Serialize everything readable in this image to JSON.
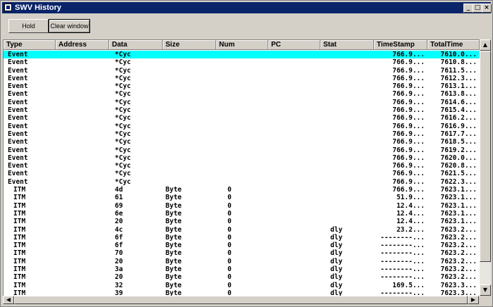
{
  "window": {
    "title": "SWV History"
  },
  "toolbar": {
    "hold_label": "Hold",
    "clear_label": "Clear window"
  },
  "table": {
    "columns": [
      "Type",
      "Address",
      "Data",
      "Size",
      "Num",
      "PC",
      "Stat",
      "TimeStamp",
      "TotalTime"
    ],
    "rows": [
      {
        "type": "Event",
        "address": "",
        "data": "*Cyc",
        "size": "",
        "num": "",
        "pc": "",
        "stat": "",
        "timestamp": "766.9...",
        "totaltime": "7610.0...",
        "selected": true
      },
      {
        "type": "Event",
        "address": "",
        "data": "*Cyc",
        "size": "",
        "num": "",
        "pc": "",
        "stat": "",
        "timestamp": "766.9...",
        "totaltime": "7610.8..."
      },
      {
        "type": "Event",
        "address": "",
        "data": "*Cyc",
        "size": "",
        "num": "",
        "pc": "",
        "stat": "",
        "timestamp": "766.9...",
        "totaltime": "7611.5..."
      },
      {
        "type": "Event",
        "address": "",
        "data": "*Cyc",
        "size": "",
        "num": "",
        "pc": "",
        "stat": "",
        "timestamp": "766.9...",
        "totaltime": "7612.3..."
      },
      {
        "type": "Event",
        "address": "",
        "data": "*Cyc",
        "size": "",
        "num": "",
        "pc": "",
        "stat": "",
        "timestamp": "766.9...",
        "totaltime": "7613.1..."
      },
      {
        "type": "Event",
        "address": "",
        "data": "*Cyc",
        "size": "",
        "num": "",
        "pc": "",
        "stat": "",
        "timestamp": "766.9...",
        "totaltime": "7613.8..."
      },
      {
        "type": "Event",
        "address": "",
        "data": "*Cyc",
        "size": "",
        "num": "",
        "pc": "",
        "stat": "",
        "timestamp": "766.9...",
        "totaltime": "7614.6..."
      },
      {
        "type": "Event",
        "address": "",
        "data": "*Cyc",
        "size": "",
        "num": "",
        "pc": "",
        "stat": "",
        "timestamp": "766.9...",
        "totaltime": "7615.4..."
      },
      {
        "type": "Event",
        "address": "",
        "data": "*Cyc",
        "size": "",
        "num": "",
        "pc": "",
        "stat": "",
        "timestamp": "766.9...",
        "totaltime": "7616.2..."
      },
      {
        "type": "Event",
        "address": "",
        "data": "*Cyc",
        "size": "",
        "num": "",
        "pc": "",
        "stat": "",
        "timestamp": "766.9...",
        "totaltime": "7616.9..."
      },
      {
        "type": "Event",
        "address": "",
        "data": "*Cyc",
        "size": "",
        "num": "",
        "pc": "",
        "stat": "",
        "timestamp": "766.9...",
        "totaltime": "7617.7..."
      },
      {
        "type": "Event",
        "address": "",
        "data": "*Cyc",
        "size": "",
        "num": "",
        "pc": "",
        "stat": "",
        "timestamp": "766.9...",
        "totaltime": "7618.5..."
      },
      {
        "type": "Event",
        "address": "",
        "data": "*Cyc",
        "size": "",
        "num": "",
        "pc": "",
        "stat": "",
        "timestamp": "766.9...",
        "totaltime": "7619.2..."
      },
      {
        "type": "Event",
        "address": "",
        "data": "*Cyc",
        "size": "",
        "num": "",
        "pc": "",
        "stat": "",
        "timestamp": "766.9...",
        "totaltime": "7620.0..."
      },
      {
        "type": "Event",
        "address": "",
        "data": "*Cyc",
        "size": "",
        "num": "",
        "pc": "",
        "stat": "",
        "timestamp": "766.9...",
        "totaltime": "7620.8..."
      },
      {
        "type": "Event",
        "address": "",
        "data": "*Cyc",
        "size": "",
        "num": "",
        "pc": "",
        "stat": "",
        "timestamp": "766.9...",
        "totaltime": "7621.5..."
      },
      {
        "type": "Event",
        "address": "",
        "data": "*Cyc",
        "size": "",
        "num": "",
        "pc": "",
        "stat": "",
        "timestamp": "766.9...",
        "totaltime": "7622.3..."
      },
      {
        "type": "ITM",
        "address": "",
        "data": "4d",
        "size": "Byte",
        "num": "0",
        "pc": "",
        "stat": "",
        "timestamp": "766.9...",
        "totaltime": "7623.1..."
      },
      {
        "type": "ITM",
        "address": "",
        "data": "61",
        "size": "Byte",
        "num": "0",
        "pc": "",
        "stat": "",
        "timestamp": "51.9...",
        "totaltime": "7623.1..."
      },
      {
        "type": "ITM",
        "address": "",
        "data": "69",
        "size": "Byte",
        "num": "0",
        "pc": "",
        "stat": "",
        "timestamp": "12.4...",
        "totaltime": "7623.1..."
      },
      {
        "type": "ITM",
        "address": "",
        "data": "6e",
        "size": "Byte",
        "num": "0",
        "pc": "",
        "stat": "",
        "timestamp": "12.4...",
        "totaltime": "7623.1..."
      },
      {
        "type": "ITM",
        "address": "",
        "data": "20",
        "size": "Byte",
        "num": "0",
        "pc": "",
        "stat": "",
        "timestamp": "12.4...",
        "totaltime": "7623.1..."
      },
      {
        "type": "ITM",
        "address": "",
        "data": "4c",
        "size": "Byte",
        "num": "0",
        "pc": "",
        "stat": "dly",
        "timestamp": "23.2...",
        "totaltime": "7623.2..."
      },
      {
        "type": "ITM",
        "address": "",
        "data": "6f",
        "size": "Byte",
        "num": "0",
        "pc": "",
        "stat": "dly",
        "timestamp": "--------...",
        "totaltime": "7623.2..."
      },
      {
        "type": "ITM",
        "address": "",
        "data": "6f",
        "size": "Byte",
        "num": "0",
        "pc": "",
        "stat": "dly",
        "timestamp": "--------...",
        "totaltime": "7623.2..."
      },
      {
        "type": "ITM",
        "address": "",
        "data": "70",
        "size": "Byte",
        "num": "0",
        "pc": "",
        "stat": "dly",
        "timestamp": "--------...",
        "totaltime": "7623.2..."
      },
      {
        "type": "ITM",
        "address": "",
        "data": "20",
        "size": "Byte",
        "num": "0",
        "pc": "",
        "stat": "dly",
        "timestamp": "--------...",
        "totaltime": "7623.2..."
      },
      {
        "type": "ITM",
        "address": "",
        "data": "3a",
        "size": "Byte",
        "num": "0",
        "pc": "",
        "stat": "dly",
        "timestamp": "--------...",
        "totaltime": "7623.2..."
      },
      {
        "type": "ITM",
        "address": "",
        "data": "20",
        "size": "Byte",
        "num": "0",
        "pc": "",
        "stat": "dly",
        "timestamp": "--------...",
        "totaltime": "7623.2..."
      },
      {
        "type": "ITM",
        "address": "",
        "data": "32",
        "size": "Byte",
        "num": "0",
        "pc": "",
        "stat": "dly",
        "timestamp": "169.5...",
        "totaltime": "7623.3..."
      },
      {
        "type": "ITM",
        "address": "",
        "data": "39",
        "size": "Byte",
        "num": "0",
        "pc": "",
        "stat": "dly",
        "timestamp": "--------...",
        "totaltime": "7623.3..."
      }
    ]
  },
  "colors": {
    "title_bar": "#0a246a",
    "selection": "#00ffff",
    "chrome": "#d4d0c8"
  },
  "icons": {
    "minimize": "minimize-icon",
    "maximize": "maximize-icon",
    "close": "close-icon"
  }
}
